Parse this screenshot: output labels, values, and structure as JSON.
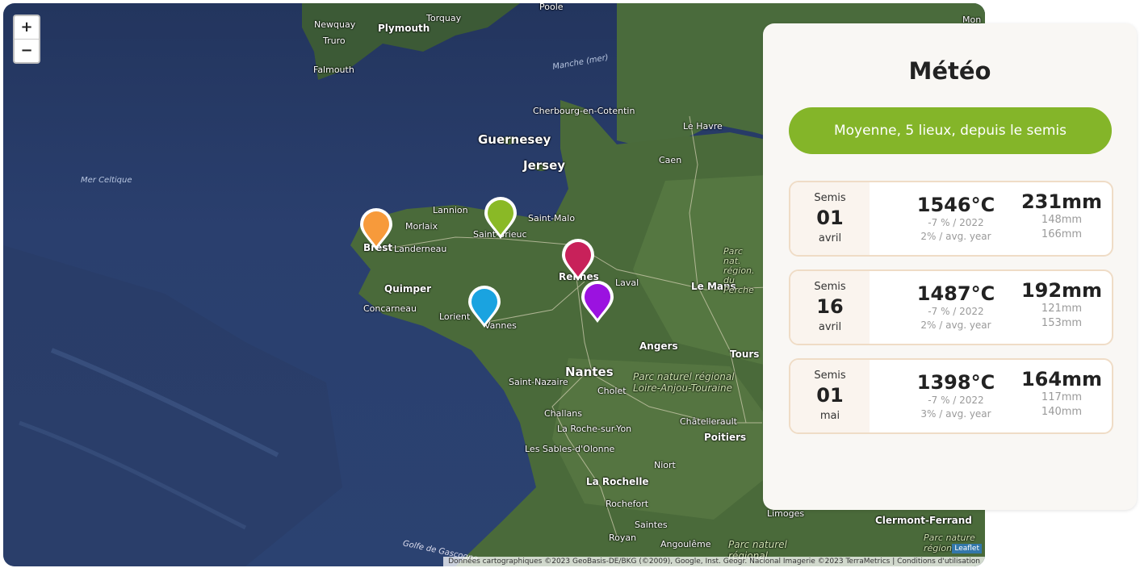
{
  "map": {
    "zoom_in": "+",
    "zoom_out": "−",
    "labels": {
      "poole": "Poole",
      "newquay": "Newquay",
      "torquay": "Torquay",
      "plymouth": "Plymouth",
      "truro": "Truro",
      "falmouth": "Falmouth",
      "manche": "Manche (mer)",
      "mer_celtique": "Mer Celtique",
      "cherbourg": "Cherbourg-en-Cotentin",
      "guernesey": "Guernesey",
      "jersey": "Jersey",
      "le_havre": "Le Havre",
      "caen": "Caen",
      "lannion": "Lannion",
      "morlaix": "Morlaix",
      "saint_malo": "Saint-Malo",
      "saint_brieuc": "Saint-Brieuc",
      "brest": "Brest",
      "landerneau": "Landerneau",
      "quimper": "Quimper",
      "concarneau": "Concarneau",
      "lorient": "Lorient",
      "vannes": "Vannes",
      "rennes": "Rennes",
      "laval": "Laval",
      "le_mans": "Le Mans",
      "parc_normandie": "Parc nat. région. du Perche",
      "angers": "Angers",
      "tours": "Tours",
      "nantes": "Nantes",
      "saint_nazaire": "Saint-Nazaire",
      "cholet": "Cholet",
      "parc_loire": "Parc naturel régional Loire-Anjou-Touraine",
      "challans": "Challans",
      "la_roche": "La Roche-sur-Yon",
      "chatellerault": "Châtellerault",
      "poitiers": "Poitiers",
      "sables": "Les Sables-d'Olonne",
      "niort": "Niort",
      "la_rochelle": "La Rochelle",
      "rochefort": "Rochefort",
      "saintes": "Saintes",
      "royan": "Royan",
      "angouleme": "Angoulême",
      "limoges": "Limoges",
      "clermont": "Clermont-Ferrand",
      "mon": "Mon",
      "gascogne": "Golfe de Gascogne",
      "parc_perigord": "Parc naturel régional",
      "parc_nature": "Parc nature régional"
    },
    "markers": [
      {
        "color": "#f79a3b"
      },
      {
        "color": "#8ab926"
      },
      {
        "color": "#c8215a"
      },
      {
        "color": "#1aa3e0"
      },
      {
        "color": "#9b12e0"
      }
    ],
    "attribution": "Données cartographiques ©2023 GeoBasis-DE/BKG (©2009), Google, Inst. Geogr. Nacional Imagerie ©2023 TerraMetrics | Conditions d'utilisation",
    "leaflet": "Leaflet"
  },
  "panel": {
    "title": "Météo",
    "filter_button": "Moyenne, 5 lieux, depuis le semis",
    "cards": [
      {
        "semis": "Semis",
        "day": "01",
        "month": "avril",
        "temp": "1546°C",
        "temp_vs_2022": "-7 % / 2022",
        "temp_vs_avg": "2% / avg. year",
        "rain": "231mm",
        "rain_2022": "148mm",
        "rain_avg": "166mm"
      },
      {
        "semis": "Semis",
        "day": "16",
        "month": "avril",
        "temp": "1487°C",
        "temp_vs_2022": "-7 % / 2022",
        "temp_vs_avg": "2% / avg. year",
        "rain": "192mm",
        "rain_2022": "121mm",
        "rain_avg": "153mm"
      },
      {
        "semis": "Semis",
        "day": "01",
        "month": "mai",
        "temp": "1398°C",
        "temp_vs_2022": "-7 % / 2022",
        "temp_vs_avg": "3% / avg. year",
        "rain": "164mm",
        "rain_2022": "117mm",
        "rain_avg": "140mm"
      }
    ]
  }
}
